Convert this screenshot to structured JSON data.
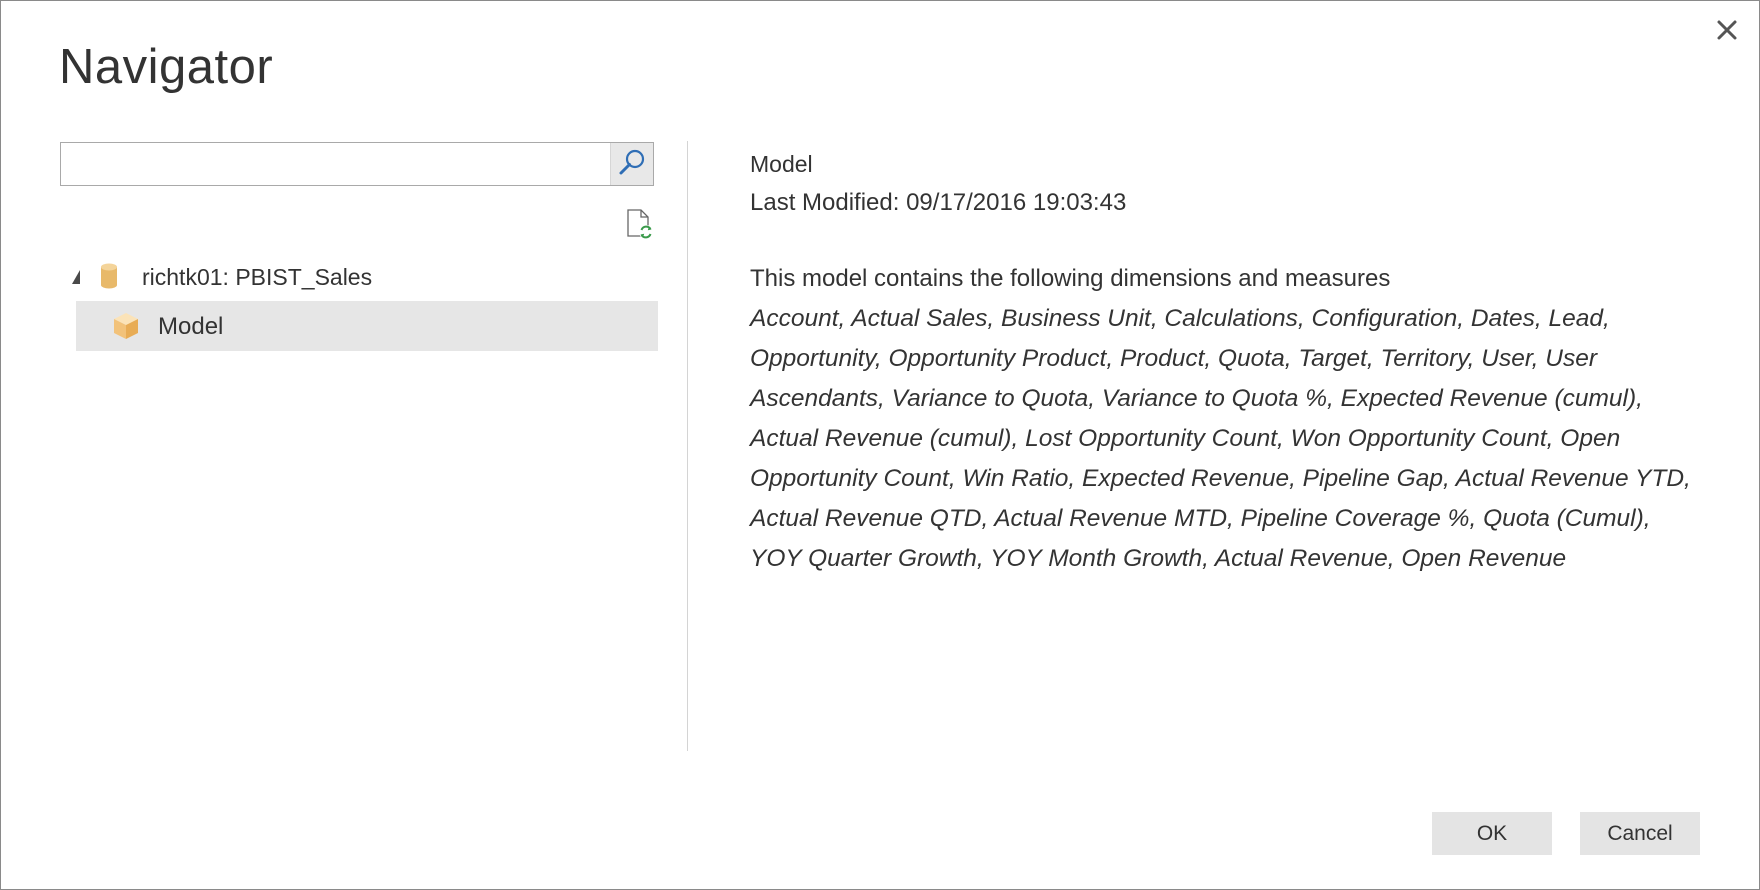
{
  "dialog": {
    "title": "Navigator",
    "close_icon": "close-icon"
  },
  "search": {
    "value": "",
    "placeholder": "",
    "icon": "search-icon"
  },
  "toolbar": {
    "refresh_icon": "refresh-document-icon"
  },
  "tree": {
    "root": {
      "label": "richtk01: PBIST_Sales",
      "icon": "database-icon",
      "expanded": true
    },
    "children": [
      {
        "label": "Model",
        "icon": "cube-icon",
        "selected": true
      }
    ]
  },
  "details": {
    "name": "Model",
    "last_modified": "Last Modified: 09/17/2016 19:03:43",
    "description_heading": "This model contains the following dimensions and measures",
    "items": "Account, Actual Sales, Business Unit, Calculations, Configuration, Dates, Lead, Opportunity, Opportunity Product, Product, Quota, Target, Territory, User, User Ascendants, Variance to Quota, Variance to Quota %, Expected Revenue (cumul), Actual Revenue (cumul), Lost Opportunity Count, Won Opportunity Count, Open Opportunity Count, Win Ratio, Expected Revenue, Pipeline Gap, Actual Revenue YTD, Actual Revenue QTD, Actual Revenue MTD, Pipeline Coverage %, Quota (Cumul), YOY Quarter Growth, YOY Month Growth, Actual Revenue, Open Revenue"
  },
  "footer": {
    "ok_label": "OK",
    "cancel_label": "Cancel"
  },
  "colors": {
    "selected_row": "#e6e6e6",
    "button_bg": "#e4e4e4",
    "cube_icon": "#f2c27a",
    "database_icon": "#e8b96a",
    "search_icon": "#2f6eb5",
    "refresh_badge": "#3a9a4a"
  }
}
